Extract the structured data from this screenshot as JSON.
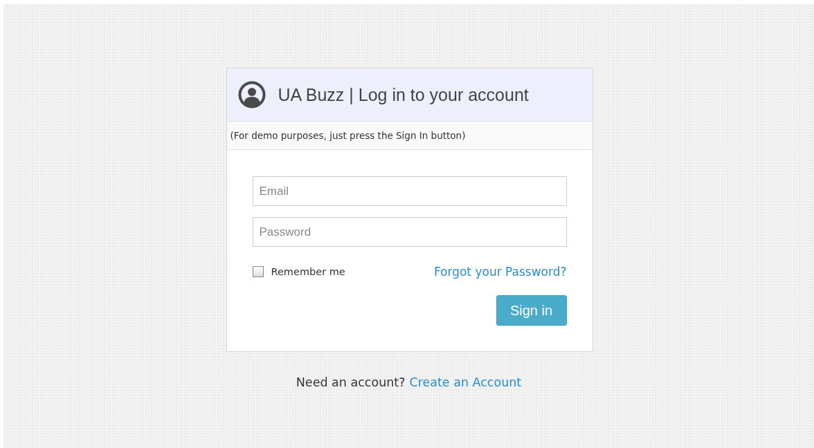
{
  "card": {
    "title": "UA Buzz | Log in to your account",
    "note": "(For demo purposes, just press the Sign In button)"
  },
  "fields": [
    {
      "placeholder": "Email"
    },
    {
      "placeholder": "Password"
    }
  ],
  "remember": {
    "label": "Remember me",
    "checked": false
  },
  "forgot_link": "Forgot your Password?",
  "sign_in_button": "Sign in",
  "footer": {
    "text": "Need an account?",
    "link": "Create an Account"
  }
}
